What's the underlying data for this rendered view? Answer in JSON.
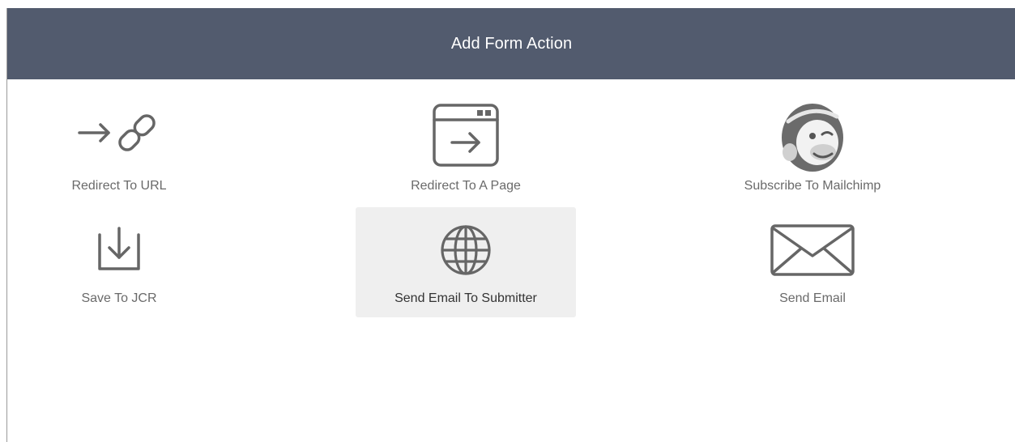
{
  "dialog": {
    "title": "Add Form Action"
  },
  "actions": [
    {
      "label": "Redirect To URL",
      "icon": "arrow-link-icon"
    },
    {
      "label": "Redirect To A Page",
      "icon": "browser-window-arrow-icon"
    },
    {
      "label": "Subscribe To Mailchimp",
      "icon": "mailchimp-icon"
    },
    {
      "label": "Save To JCR",
      "icon": "save-download-icon"
    },
    {
      "label": "Send Email To Submitter",
      "icon": "globe-icon",
      "selected": true
    },
    {
      "label": "Send Email",
      "icon": "envelope-icon"
    }
  ],
  "colors": {
    "header": "#525b6e",
    "icon": "#666666",
    "selected_background": "#efefef"
  }
}
